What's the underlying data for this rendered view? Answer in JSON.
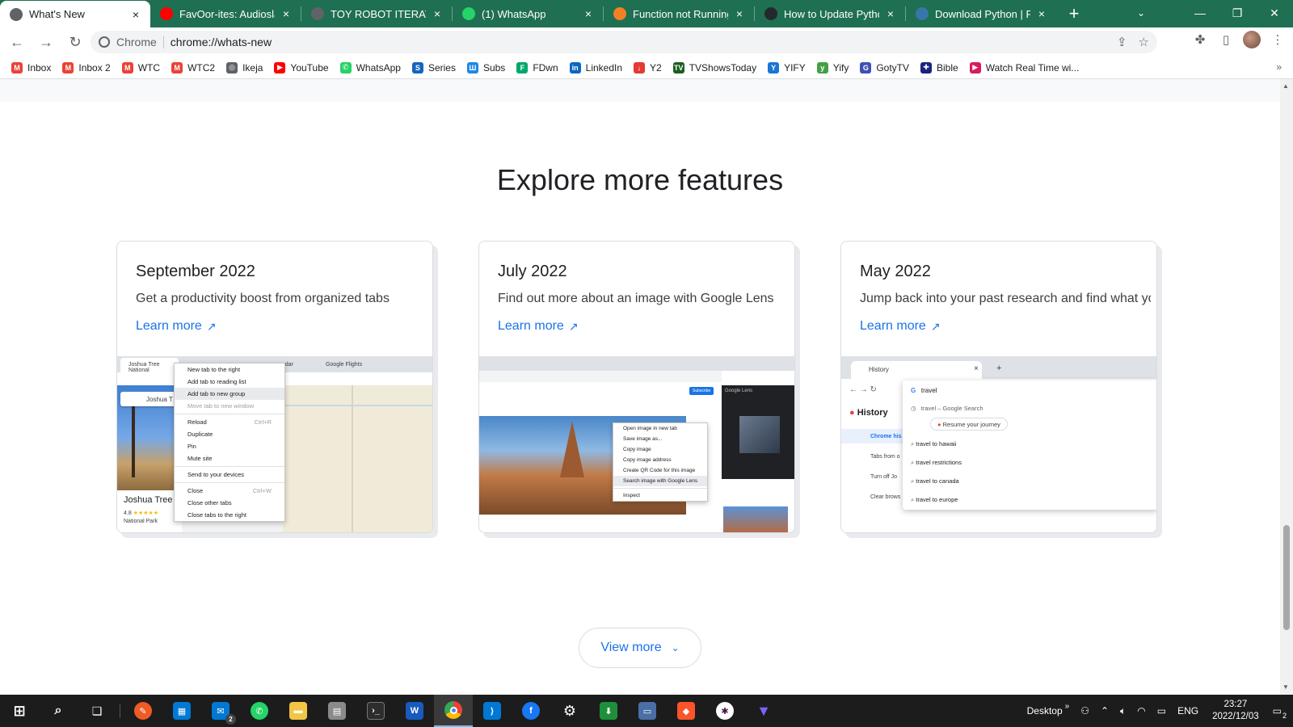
{
  "browser": {
    "tabs": [
      {
        "title": "What's New",
        "active": true,
        "favicon": "chrome-icon",
        "color": "#5f6368"
      },
      {
        "title": "FavOor-ites: Audioslave",
        "active": false,
        "favicon": "youtube-icon",
        "color": "#ff0000"
      },
      {
        "title": "TOY ROBOT ITERATION",
        "active": false,
        "favicon": "globe-icon",
        "color": "#5f6368"
      },
      {
        "title": "(1) WhatsApp",
        "active": false,
        "favicon": "whatsapp-icon",
        "color": "#25d366"
      },
      {
        "title": "Function not Running in",
        "active": false,
        "favicon": "stackoverflow-icon",
        "color": "#f48024"
      },
      {
        "title": "How to Update Python",
        "active": false,
        "favicon": "github-icon",
        "color": "#24292e"
      },
      {
        "title": "Download Python | Pyth",
        "active": false,
        "favicon": "python-icon",
        "color": "#3776ab"
      }
    ],
    "chrome_chip": "Chrome",
    "url": "chrome://whats-new"
  },
  "bookmarks": [
    {
      "label": "Inbox",
      "icon": "gmail-icon",
      "color": "#ea4335",
      "glyph": "M"
    },
    {
      "label": "Inbox 2",
      "icon": "gmail-icon",
      "color": "#ea4335",
      "glyph": "M"
    },
    {
      "label": "WTC",
      "icon": "gmail-icon",
      "color": "#ea4335",
      "glyph": "M"
    },
    {
      "label": "WTC2",
      "icon": "gmail-icon",
      "color": "#ea4335",
      "glyph": "M"
    },
    {
      "label": "Ikeja",
      "icon": "globe-icon",
      "color": "#5f6368",
      "glyph": "◎"
    },
    {
      "label": "YouTube",
      "icon": "youtube-icon",
      "color": "#ff0000",
      "glyph": "▶"
    },
    {
      "label": "WhatsApp",
      "icon": "whatsapp-icon",
      "color": "#25d366",
      "glyph": "✆"
    },
    {
      "label": "Series",
      "icon": "series-icon",
      "color": "#1565c0",
      "glyph": "S"
    },
    {
      "label": "Subs",
      "icon": "subs-icon",
      "color": "#1e88e5",
      "glyph": "Ш"
    },
    {
      "label": "FDwn",
      "icon": "fdwn-icon",
      "color": "#00a86b",
      "glyph": "F"
    },
    {
      "label": "LinkedIn",
      "icon": "linkedin-icon",
      "color": "#0a66c2",
      "glyph": "in"
    },
    {
      "label": "Y2",
      "icon": "download-icon",
      "color": "#e53935",
      "glyph": "↓"
    },
    {
      "label": "TVShowsToday",
      "icon": "tv-icon",
      "color": "#1b5e20",
      "glyph": "TV"
    },
    {
      "label": "YIFY",
      "icon": "yify-icon",
      "color": "#1976d2",
      "glyph": "Y"
    },
    {
      "label": "Yify",
      "icon": "yify-icon",
      "color": "#43a047",
      "glyph": "y"
    },
    {
      "label": "GotyTV",
      "icon": "goty-icon",
      "color": "#3f51b5",
      "glyph": "G"
    },
    {
      "label": "Bible",
      "icon": "bible-icon",
      "color": "#1a237e",
      "glyph": "✚"
    },
    {
      "label": "Watch Real Time wi...",
      "icon": "play-icon",
      "color": "#d81b60",
      "glyph": "▶"
    }
  ],
  "main": {
    "section_title": "Explore more features",
    "cards": [
      {
        "date": "September 2022",
        "desc": "Get a productivity boost from organized tabs",
        "link": "Learn more"
      },
      {
        "date": "July 2022",
        "desc": "Find out more about an image with Google Lens",
        "link": "Learn more"
      },
      {
        "date": "May 2022",
        "desc": "Jump back into your past research and find what you were looking for",
        "link": "Learn more"
      }
    ],
    "view_more": "View more"
  },
  "mini_sep": {
    "tab1": "Joshua Tree National",
    "tab2": "endar",
    "tab3": "Google Flights",
    "search": "Joshua T",
    "place": "Joshua Tree",
    "rating": "4.8",
    "subtitle": "National Park",
    "menu": [
      "New tab to the right",
      "Add tab to reading list",
      "Add tab to new group",
      "Move tab to new window",
      "Reload",
      "Duplicate",
      "Pin",
      "Mute site",
      "Send to your devices",
      "Close",
      "Close other tabs",
      "Close tabs to the right"
    ],
    "reload_key": "Ctrl+R",
    "close_key": "Ctrl+W"
  },
  "mini_jul": {
    "menu": [
      "Open image in new tab",
      "Save image as...",
      "Copy image",
      "Copy image address",
      "Create QR Code for this image",
      "Search image with Google Lens",
      "Inspect"
    ],
    "lens_title": "Google Lens",
    "subscribe": "Subscribe"
  },
  "mini_may": {
    "tab": "History",
    "heading": "History",
    "query": "travel",
    "google_search": "travel – Google Search",
    "resume": "Resume your journey",
    "suggestions": [
      "travel to hawaii",
      "travel restrictions",
      "travel to canada",
      "travel to europe"
    ],
    "sidebar": [
      "Chrome his",
      "Tabs from o",
      "Turn off Jo",
      "Clear brows"
    ]
  },
  "taskbar": {
    "desktop_label": "Desktop",
    "language": "ENG",
    "time": "23:27",
    "date": "2022/12/03",
    "notifications": "2",
    "mail_badge": "2"
  },
  "colors": {
    "tabstrip": "#1f6f52",
    "link": "#1a73e8",
    "taskbar": "#1c1c1c"
  }
}
